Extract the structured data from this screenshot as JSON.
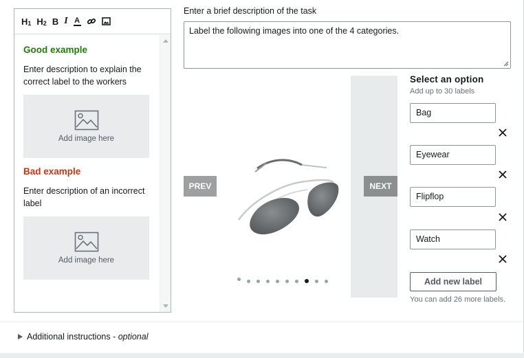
{
  "toolbar": {
    "h1": "H",
    "h1_sub": "1",
    "h2": "H",
    "h2_sub": "2",
    "bold": "B",
    "italic": "I",
    "font_color": "A"
  },
  "examples": {
    "good_title": "Good example",
    "good_desc": "Enter description to explain the correct label to the workers",
    "bad_title": "Bad example",
    "bad_desc": "Enter description of an incorrect label",
    "image_placeholder": "Add image here"
  },
  "task": {
    "label": "Enter a brief description of the task",
    "value": "Label the following images into one of the 4 categories."
  },
  "carousel": {
    "prev": "PREV",
    "next": "NEXT",
    "total_slides": 10,
    "active_slide": 8
  },
  "options": {
    "title": "Select an option",
    "subtitle": "Add up to 30 labels",
    "labels": [
      "Bag",
      "Eyewear",
      "Flipflop",
      "Watch"
    ],
    "add_button": "Add new label",
    "remaining_note": "You can add 26 more labels."
  },
  "additional": {
    "text": "Additional instructions - ",
    "optional": "optional"
  },
  "icons": [
    "heading1-icon",
    "heading2-icon",
    "bold-icon",
    "italic-icon",
    "font-color-icon",
    "link-icon",
    "image-icon",
    "close-icon",
    "caret-right-icon"
  ],
  "colors": {
    "good": "#1d8102",
    "bad": "#d13212",
    "carousel_button": "#8c8f90"
  }
}
